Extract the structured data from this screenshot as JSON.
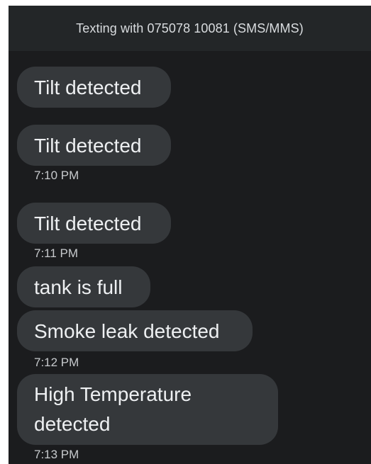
{
  "header": {
    "title": "Texting with 075078 10081 (SMS/MMS)"
  },
  "messages": [
    {
      "text": "Tilt detected"
    },
    {
      "text": "Tilt detected"
    },
    {
      "text": "Tilt detected"
    },
    {
      "text": "tank is full"
    },
    {
      "text": "Smoke leak detected"
    },
    {
      "text": "High Temperature detected"
    }
  ],
  "timestamps": [
    "7:10 PM",
    "7:11 PM",
    "7:12 PM",
    "7:13 PM"
  ]
}
